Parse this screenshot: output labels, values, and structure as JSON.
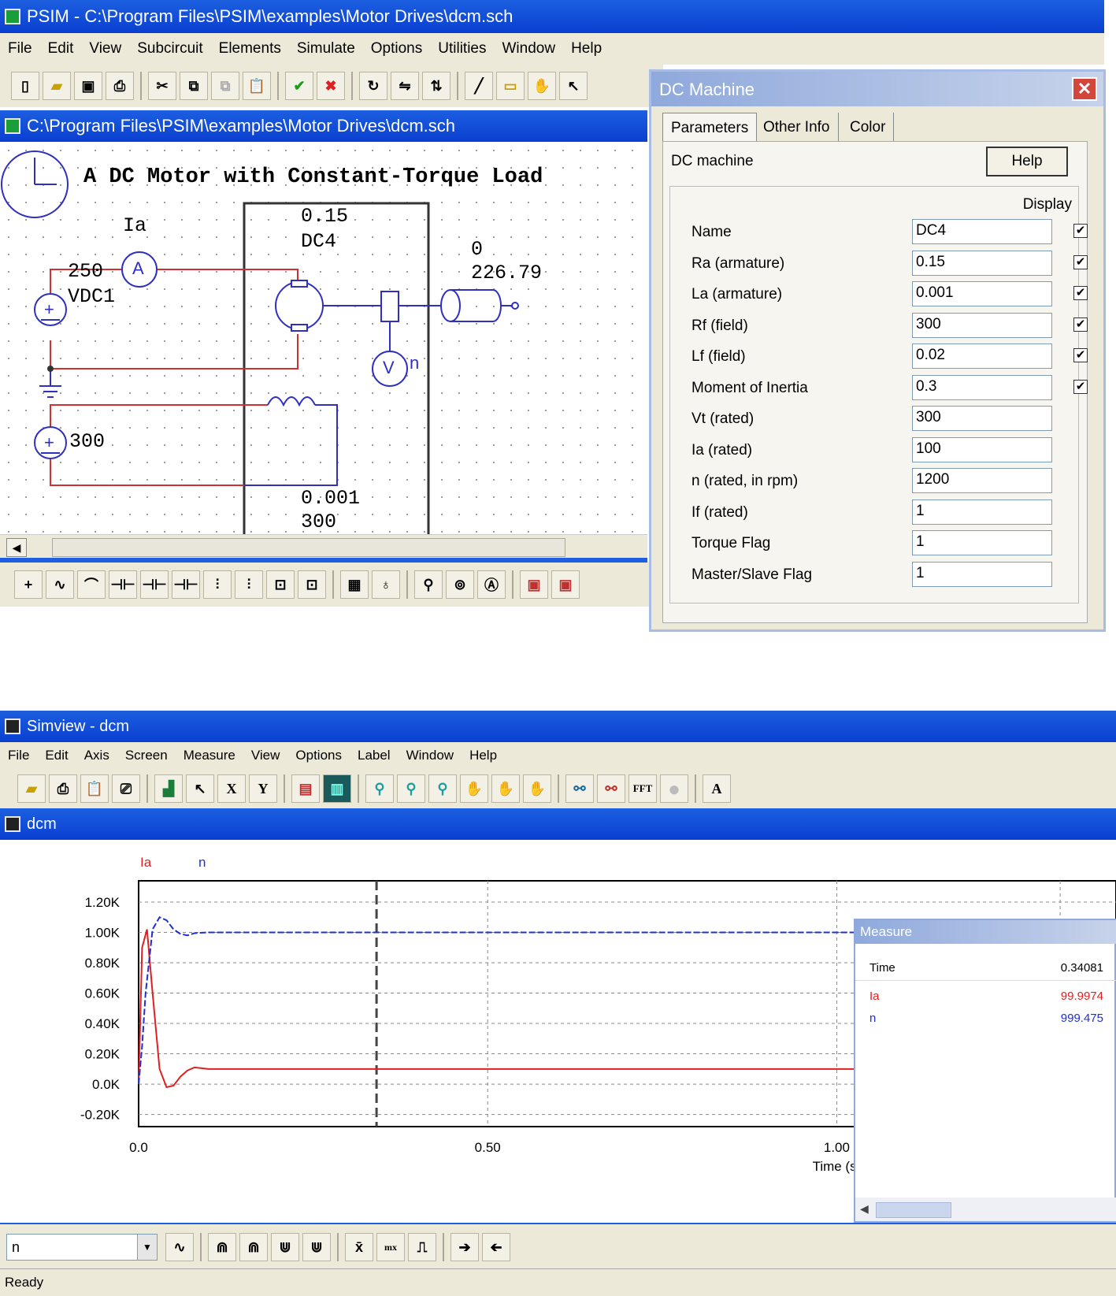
{
  "psim": {
    "title": "PSIM - C:\\Program Files\\PSIM\\examples\\Motor Drives\\dcm.sch",
    "menu": [
      "File",
      "Edit",
      "View",
      "Subcircuit",
      "Elements",
      "Simulate",
      "Options",
      "Utilities",
      "Window",
      "Help"
    ],
    "schematic_title": "C:\\Program Files\\PSIM\\examples\\Motor Drives\\dcm.sch",
    "circuit": {
      "heading": "A DC Motor with Constant-Torque Load",
      "ammeter_label": "Ia",
      "ammeter_symbol": "A",
      "voltmeter_symbol": "V",
      "voltmeter_label": "n",
      "source_voltage": "250",
      "source_name": "VDC1",
      "field_voltage": "300",
      "ra_value": "0.15",
      "machine_name": "DC4",
      "la_value": "0.001",
      "rf_value": "300",
      "load_value1": "0",
      "load_value2": "226.79"
    }
  },
  "dialog": {
    "title": "DC Machine",
    "tabs": [
      "Parameters",
      "Other Info",
      "Color"
    ],
    "machine_label": "DC machine",
    "help_label": "Help",
    "display_label": "Display",
    "params": [
      {
        "label": "Name",
        "value": "DC4",
        "checked": true
      },
      {
        "label": "Ra (armature)",
        "value": "0.15",
        "checked": true
      },
      {
        "label": "La (armature)",
        "value": "0.001",
        "checked": true
      },
      {
        "label": "Rf (field)",
        "value": "300",
        "checked": true
      },
      {
        "label": "Lf (field)",
        "value": "0.02",
        "checked": true
      },
      {
        "label": "Moment of Inertia",
        "value": "0.3",
        "checked": true
      },
      {
        "label": "Vt (rated)",
        "value": "300",
        "checked": false
      },
      {
        "label": "Ia (rated)",
        "value": "100",
        "checked": false
      },
      {
        "label": "n (rated, in rpm)",
        "value": "1200",
        "checked": false
      },
      {
        "label": "If (rated)",
        "value": "1",
        "checked": false
      },
      {
        "label": "Torque Flag",
        "value": "1",
        "checked": false
      },
      {
        "label": "Master/Slave Flag",
        "value": "1",
        "checked": false
      }
    ]
  },
  "simview": {
    "title": "Simview - dcm",
    "menu": [
      "File",
      "Edit",
      "Axis",
      "Screen",
      "Measure",
      "View",
      "Options",
      "Label",
      "Window",
      "Help"
    ],
    "toolbar_letters": [
      "X",
      "Y",
      "FFT",
      "A"
    ],
    "subwindow_title": "dcm",
    "measure": {
      "title": "Measure",
      "rows": [
        {
          "label": "Time",
          "value": "0.34081",
          "color": "#000000"
        },
        {
          "label": "Ia",
          "value": "99.9974",
          "color": "#e02020"
        },
        {
          "label": "n",
          "value": "999.475",
          "color": "#2030d0"
        }
      ]
    },
    "select_value": "n",
    "bottom_tools": [
      "mx"
    ],
    "status": "Ready"
  },
  "chart_data": {
    "type": "line",
    "xlabel": "Time (s)",
    "ylabel": "",
    "xlim": [
      0,
      1.4
    ],
    "ylim": [
      -0.28,
      1.34
    ],
    "y_unit_suffix": "K",
    "x_ticks": [
      {
        "value": 0,
        "label": "0.0"
      },
      {
        "value": 0.5,
        "label": "0.50"
      },
      {
        "value": 1.0,
        "label": "1.00"
      }
    ],
    "y_ticks": [
      {
        "value": 1.2,
        "label": "1.20K"
      },
      {
        "value": 1.0,
        "label": "1.00K"
      },
      {
        "value": 0.8,
        "label": "0.80K"
      },
      {
        "value": 0.6,
        "label": "0.60K"
      },
      {
        "value": 0.4,
        "label": "0.40K"
      },
      {
        "value": 0.2,
        "label": "0.20K"
      },
      {
        "value": 0.0,
        "label": "0.0K"
      },
      {
        "value": -0.2,
        "label": "-0.20K"
      }
    ],
    "cursor_x": 0.34081,
    "grid": true,
    "legend_placement": "top-left",
    "series": [
      {
        "name": "Ia",
        "color": "#e02020",
        "x": [
          0,
          0.005,
          0.012,
          0.02,
          0.03,
          0.04,
          0.05,
          0.06,
          0.07,
          0.08,
          0.1,
          0.15,
          0.3,
          0.6,
          1.0,
          1.4
        ],
        "y": [
          0.0,
          0.9,
          1.02,
          0.6,
          0.1,
          -0.02,
          -0.01,
          0.05,
          0.09,
          0.11,
          0.1,
          0.1,
          0.1,
          0.1,
          0.1,
          0.1
        ]
      },
      {
        "name": "n",
        "color": "#2030d0",
        "x": [
          0,
          0.005,
          0.01,
          0.02,
          0.03,
          0.04,
          0.05,
          0.06,
          0.07,
          0.08,
          0.1,
          0.15,
          0.3,
          0.6,
          1.0,
          1.4
        ],
        "y": [
          0.0,
          0.25,
          0.6,
          1.02,
          1.1,
          1.08,
          1.02,
          0.99,
          0.98,
          0.995,
          1.0,
          1.0,
          1.0,
          1.0,
          1.0,
          1.0
        ]
      }
    ]
  }
}
